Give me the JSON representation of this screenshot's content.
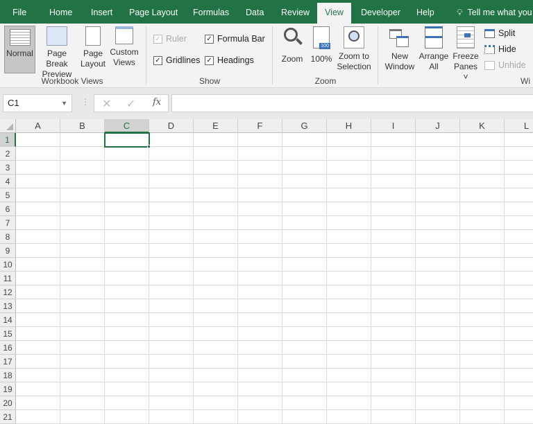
{
  "tabs": [
    "File",
    "Home",
    "Insert",
    "Page Layout",
    "Formulas",
    "Data",
    "Review",
    "View",
    "Developer",
    "Help"
  ],
  "active_tab": "View",
  "tell_me": "Tell me what you",
  "workbook_views": {
    "normal": "Normal",
    "page_break": [
      "Page Break",
      "Preview"
    ],
    "page_layout": [
      "Page",
      "Layout"
    ],
    "custom": [
      "Custom",
      "Views"
    ],
    "group": "Workbook Views"
  },
  "show": {
    "ruler": "Ruler",
    "formula_bar": "Formula Bar",
    "gridlines": "Gridlines",
    "headings": "Headings",
    "group": "Show"
  },
  "zoom": {
    "zoom": "Zoom",
    "hundred": "100%",
    "zoom_sel": [
      "Zoom to",
      "Selection"
    ],
    "group": "Zoom"
  },
  "window": {
    "new": [
      "New",
      "Window"
    ],
    "arrange": [
      "Arrange",
      "All"
    ],
    "freeze": [
      "Freeze",
      "Panes ˅"
    ],
    "split": "Split",
    "hide": "Hide",
    "unhide": "Unhide",
    "group": "Wi"
  },
  "name_box": "C1",
  "formula_value": "",
  "columns": [
    "A",
    "B",
    "C",
    "D",
    "E",
    "F",
    "G",
    "H",
    "I",
    "J",
    "K",
    "L"
  ],
  "rows": [
    "1",
    "2",
    "3",
    "4",
    "5",
    "6",
    "7",
    "8",
    "9",
    "10",
    "11",
    "12",
    "13",
    "14",
    "15",
    "16",
    "17",
    "18",
    "19",
    "20",
    "21"
  ],
  "selected_cell": "C1",
  "colors": {
    "brand": "#217346"
  }
}
